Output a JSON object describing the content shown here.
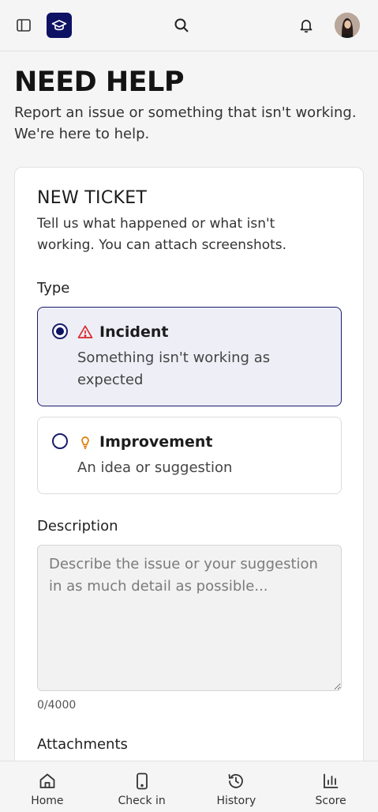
{
  "header": {
    "logo_icon": "graduation-cap-icon",
    "icons": [
      "sidebar-toggle-icon",
      "search-icon",
      "bell-icon"
    ]
  },
  "page": {
    "title": "NEED HELP",
    "subtitle": "Report an issue or something that isn't working. We're here to help."
  },
  "ticket": {
    "title": "NEW TICKET",
    "subtitle": "Tell us what happened or what isn't working. You can attach screenshots.",
    "type_label": "Type",
    "options": [
      {
        "title": "Incident",
        "desc": "Something isn't working as expected",
        "selected": true,
        "icon": "warning-triangle-icon",
        "color": "#d62828"
      },
      {
        "title": "Improvement",
        "desc": "An idea or suggestion",
        "selected": false,
        "icon": "lightbulb-icon",
        "color": "#e07b00"
      }
    ],
    "description_label": "Description",
    "description_placeholder": "Describe the issue or your suggestion in as much detail as possible...",
    "counter": "0/4000",
    "attachments_label": "Attachments"
  },
  "nav": {
    "items": [
      {
        "label": "Home",
        "icon": "home-icon"
      },
      {
        "label": "Check in",
        "icon": "phone-icon"
      },
      {
        "label": "History",
        "icon": "history-icon"
      },
      {
        "label": "Score",
        "icon": "bar-chart-icon"
      }
    ]
  },
  "colors": {
    "brand": "#0e1263",
    "selected_bg": "#eeeef7"
  }
}
